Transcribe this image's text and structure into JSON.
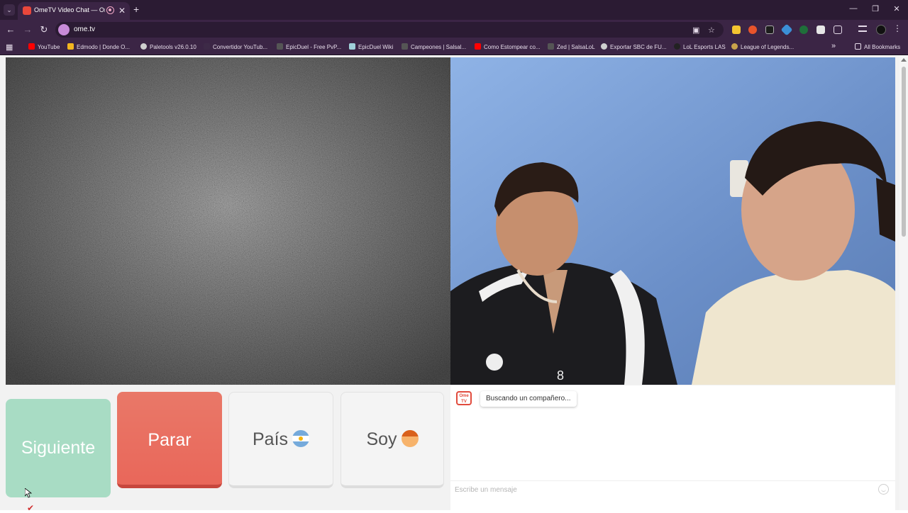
{
  "browser": {
    "tab_title": "OmeTV Video Chat — Omegl",
    "url": "ome.tv",
    "bookmarks": [
      {
        "label": "YouTube",
        "color": "#ff0000"
      },
      {
        "label": "Edmodo | Donde O...",
        "color": "#f2b61f"
      },
      {
        "label": "Paletools v26.0.10",
        "color": "#cfcfcf"
      },
      {
        "label": "Convertidor YouTub...",
        "color": "#3d2a47"
      },
      {
        "label": "EpicDuel - Free PvP...",
        "color": "#555555"
      },
      {
        "label": "EpicDuel Wiki",
        "color": "#9fd0d9"
      },
      {
        "label": "Campeones | Salsal...",
        "color": "#555555"
      },
      {
        "label": "Como Estompear co...",
        "color": "#ff0000"
      },
      {
        "label": "Zed | SalsaLoL",
        "color": "#555555"
      },
      {
        "label": "Exportar SBC de FU...",
        "color": "#cfcfcf"
      },
      {
        "label": "LoL Esports LAS",
        "color": "#222222"
      },
      {
        "label": "League of Legends...",
        "color": "#c9a24b"
      }
    ],
    "all_bookmarks": "All Bookmarks"
  },
  "controls": {
    "next_label": "Siguiente",
    "stop_label": "Parar",
    "country_label": "País",
    "gender_label": "Soy"
  },
  "chat": {
    "logo_text": "Ome TV",
    "status_message": "Buscando un compañero...",
    "input_placeholder": "Escribe un mensaje"
  }
}
